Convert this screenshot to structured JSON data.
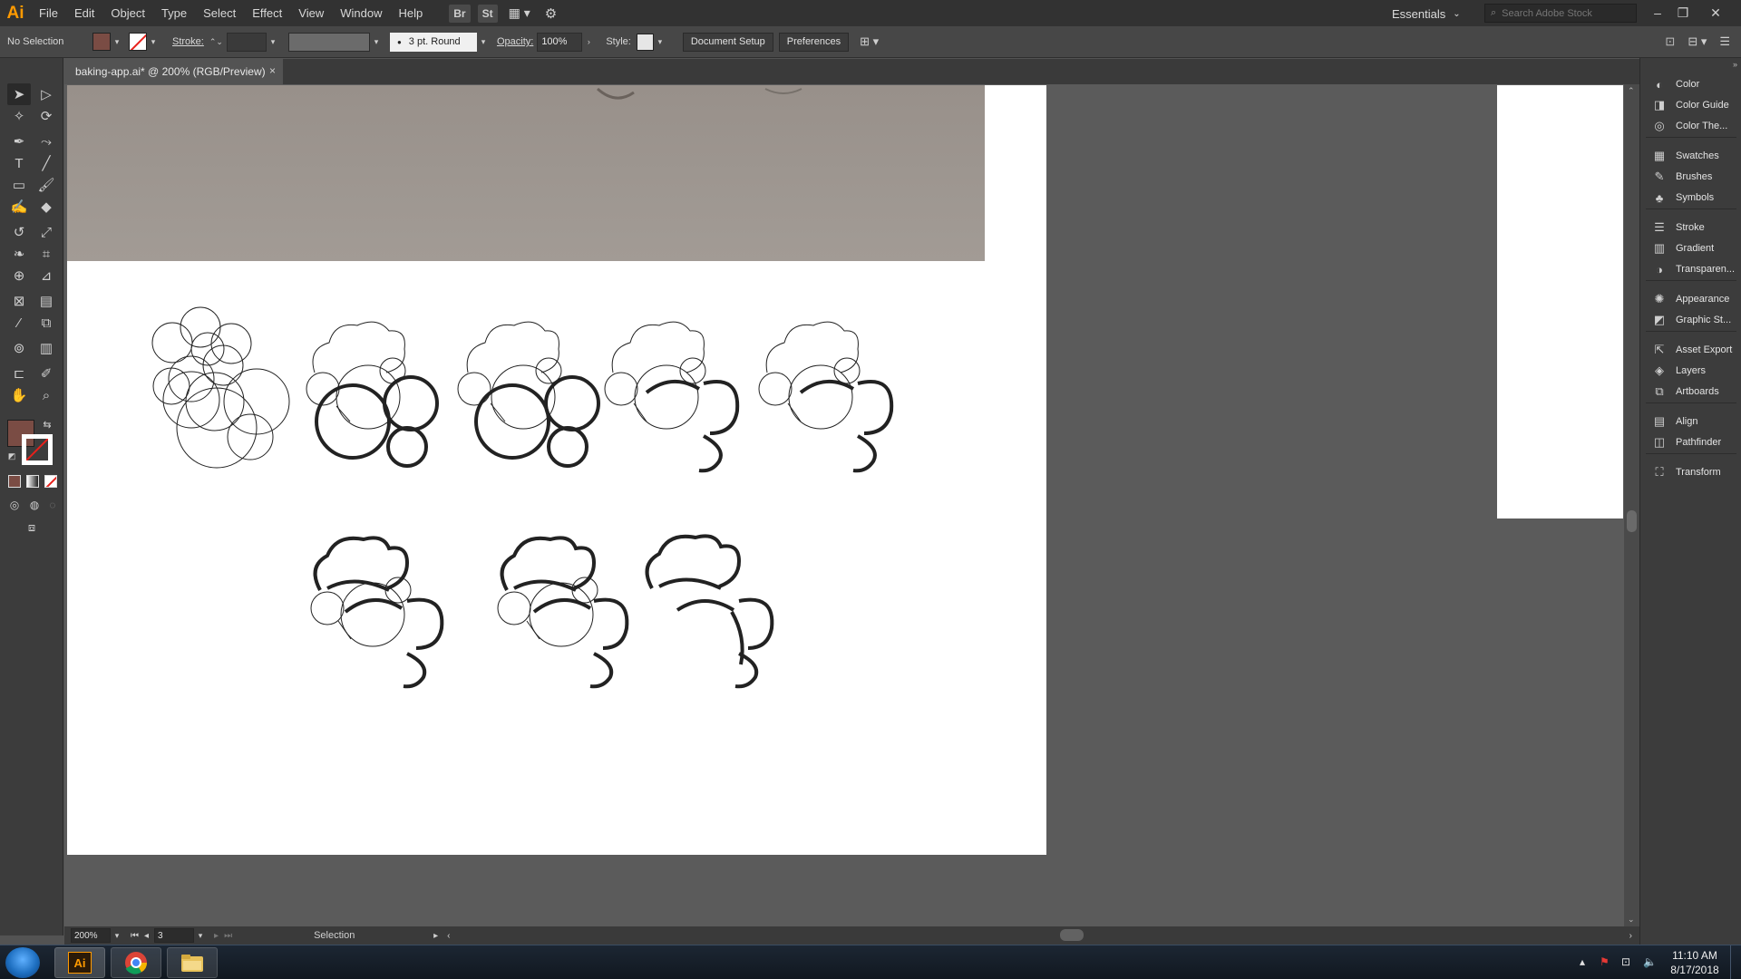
{
  "app": {
    "logo": "Ai"
  },
  "menu": [
    "File",
    "Edit",
    "Object",
    "Type",
    "Select",
    "Effect",
    "View",
    "Window",
    "Help"
  ],
  "menubar_buttons": [
    "Br",
    "St"
  ],
  "workspace": {
    "label": "Essentials"
  },
  "search": {
    "placeholder": "Search Adobe Stock"
  },
  "window_controls": {
    "minimize": "–",
    "restore": "❐",
    "close": "✕"
  },
  "control_bar": {
    "selection": "No Selection",
    "stroke_label": "Stroke:",
    "brush": "3 pt. Round",
    "opacity_label": "Opacity:",
    "opacity_value": "100%",
    "style_label": "Style:",
    "document_setup": "Document Setup",
    "preferences": "Preferences",
    "fill_color": "#7a4c44"
  },
  "document": {
    "tab_title": "baking-app.ai* @ 200% (RGB/Preview)",
    "close": "×"
  },
  "status": {
    "zoom": "200%",
    "artboard": "3",
    "tool": "Selection"
  },
  "panels": [
    {
      "label": "Color",
      "icon": "color-icon",
      "glyph": "◐"
    },
    {
      "label": "Color Guide",
      "icon": "color-guide-icon",
      "glyph": "◨"
    },
    {
      "label": "Color The...",
      "icon": "color-themes-icon",
      "glyph": "◎"
    },
    {
      "label": "Swatches",
      "icon": "swatches-icon",
      "glyph": "▦"
    },
    {
      "label": "Brushes",
      "icon": "brushes-icon",
      "glyph": "✎"
    },
    {
      "label": "Symbols",
      "icon": "symbols-icon",
      "glyph": "♣"
    },
    {
      "label": "Stroke",
      "icon": "stroke-icon",
      "glyph": "☰"
    },
    {
      "label": "Gradient",
      "icon": "gradient-icon",
      "glyph": "▥"
    },
    {
      "label": "Transparen...",
      "icon": "transparency-icon",
      "glyph": "◑"
    },
    {
      "label": "Appearance",
      "icon": "appearance-icon",
      "glyph": "✺"
    },
    {
      "label": "Graphic St...",
      "icon": "graphic-styles-icon",
      "glyph": "◩"
    },
    {
      "label": "Asset Export",
      "icon": "asset-export-icon",
      "glyph": "⇱"
    },
    {
      "label": "Layers",
      "icon": "layers-icon",
      "glyph": "◈"
    },
    {
      "label": "Artboards",
      "icon": "artboards-icon",
      "glyph": "⧉"
    },
    {
      "label": "Align",
      "icon": "align-icon",
      "glyph": "▤"
    },
    {
      "label": "Pathfinder",
      "icon": "pathfinder-icon",
      "glyph": "◫"
    },
    {
      "label": "Transform",
      "icon": "transform-icon",
      "glyph": "⛶"
    }
  ],
  "taskbar": {
    "time": "11:10 AM",
    "date": "8/17/2018",
    "illustrator_label": "Ai"
  }
}
